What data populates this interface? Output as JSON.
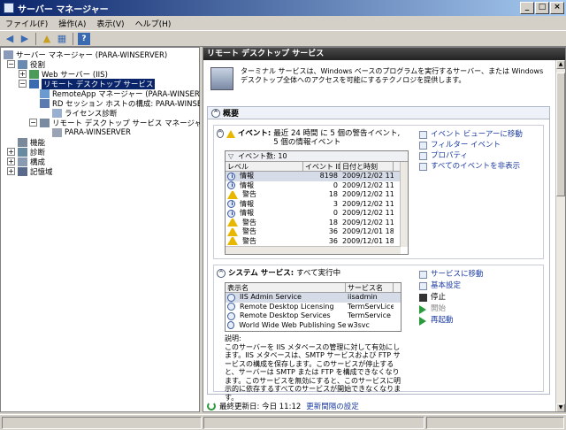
{
  "window": {
    "title": "サーバー マネージャー"
  },
  "menu": [
    "ファイル(F)",
    "操作(A)",
    "表示(V)",
    "ヘルプ(H)"
  ],
  "tree": {
    "root": "サーバー マネージャー (PARA-WINSERVER)",
    "roles": "役割",
    "web_server": "Web サーバー (IIS)",
    "rds": "リモート デスクトップ サービス",
    "remoteapp": "RemoteApp マネージャー (PARA-WINSERVER)",
    "rd_host": "RD セッション ホストの構成: PARA-WINSERVER",
    "license": "ライセンス診断",
    "rds_manager": "リモート デスクトップ サービス マネージャー",
    "server": "PARA-WINSERVER",
    "features": "機能",
    "diagnostics": "診断",
    "configuration": "構成",
    "storage": "記憶域"
  },
  "main": {
    "header": "リモート デスクトップ サービス",
    "intro": "ターミナル サービスは、Windows ベースのプログラムを実行するサーバー、または Windows デスクトップ全体へのアクセスを可能にするテクノロジを提供します。",
    "summary_title": "概要",
    "events": {
      "title": "イベント:",
      "text": "最近 24 時間 に 5 個の警告イベント, 5 個の情報イベント",
      "filter_label": "イベント数: 10",
      "columns": [
        "レベル",
        "イベント ID",
        "日付と時刻"
      ],
      "rows": [
        {
          "level": "情報",
          "type": "info",
          "id": "8198",
          "date": "2009/12/02 11:0"
        },
        {
          "level": "情報",
          "type": "info",
          "id": "0",
          "date": "2009/12/02 11:0"
        },
        {
          "level": "警告",
          "type": "warn",
          "id": "18",
          "date": "2009/12/02 11:0"
        },
        {
          "level": "情報",
          "type": "info",
          "id": "3",
          "date": "2009/12/02 11:0"
        },
        {
          "level": "情報",
          "type": "info",
          "id": "0",
          "date": "2009/12/02 11:0"
        },
        {
          "level": "警告",
          "type": "warn",
          "id": "18",
          "date": "2009/12/02 11:0"
        },
        {
          "level": "警告",
          "type": "warn",
          "id": "36",
          "date": "2009/12/01 18:4"
        },
        {
          "level": "警告",
          "type": "warn",
          "id": "36",
          "date": "2009/12/01 18:4"
        }
      ],
      "actions": [
        "イベント ビューアーに移動",
        "フィルター イベント",
        "プロパティ",
        "すべてのイベントを非表示"
      ]
    },
    "services": {
      "title": "システム サービス:",
      "status": "すべて実行中",
      "columns": [
        "表示名",
        "サービス名"
      ],
      "rows": [
        {
          "name": "IIS Admin Service",
          "svc": "iisadmin"
        },
        {
          "name": "Remote Desktop Licensing",
          "svc": "TermServLicen"
        },
        {
          "name": "Remote Desktop Services",
          "svc": "TermService"
        },
        {
          "name": "World Wide Web Publishing Service",
          "svc": "w3svc"
        }
      ],
      "desc_label": "説明:",
      "desc": "このサーバーを IIS メタベースの管理に対して有効にします。IIS メタベースは、SMTP サービスおよび FTP サービスの構成を保存します。このサービスが停止すると、サーバーは SMTP または FTP を構成できなくなります。このサービスを無効にすると、このサービスに明示的に依存するすべてのサービスが開始できなくなります。",
      "actions": [
        "サービスに移動",
        "基本設定",
        "停止",
        "開始",
        "再起動"
      ]
    },
    "refresh": {
      "label": "最終更新日: 今日 11:12",
      "link": "更新間隔の設定"
    }
  }
}
